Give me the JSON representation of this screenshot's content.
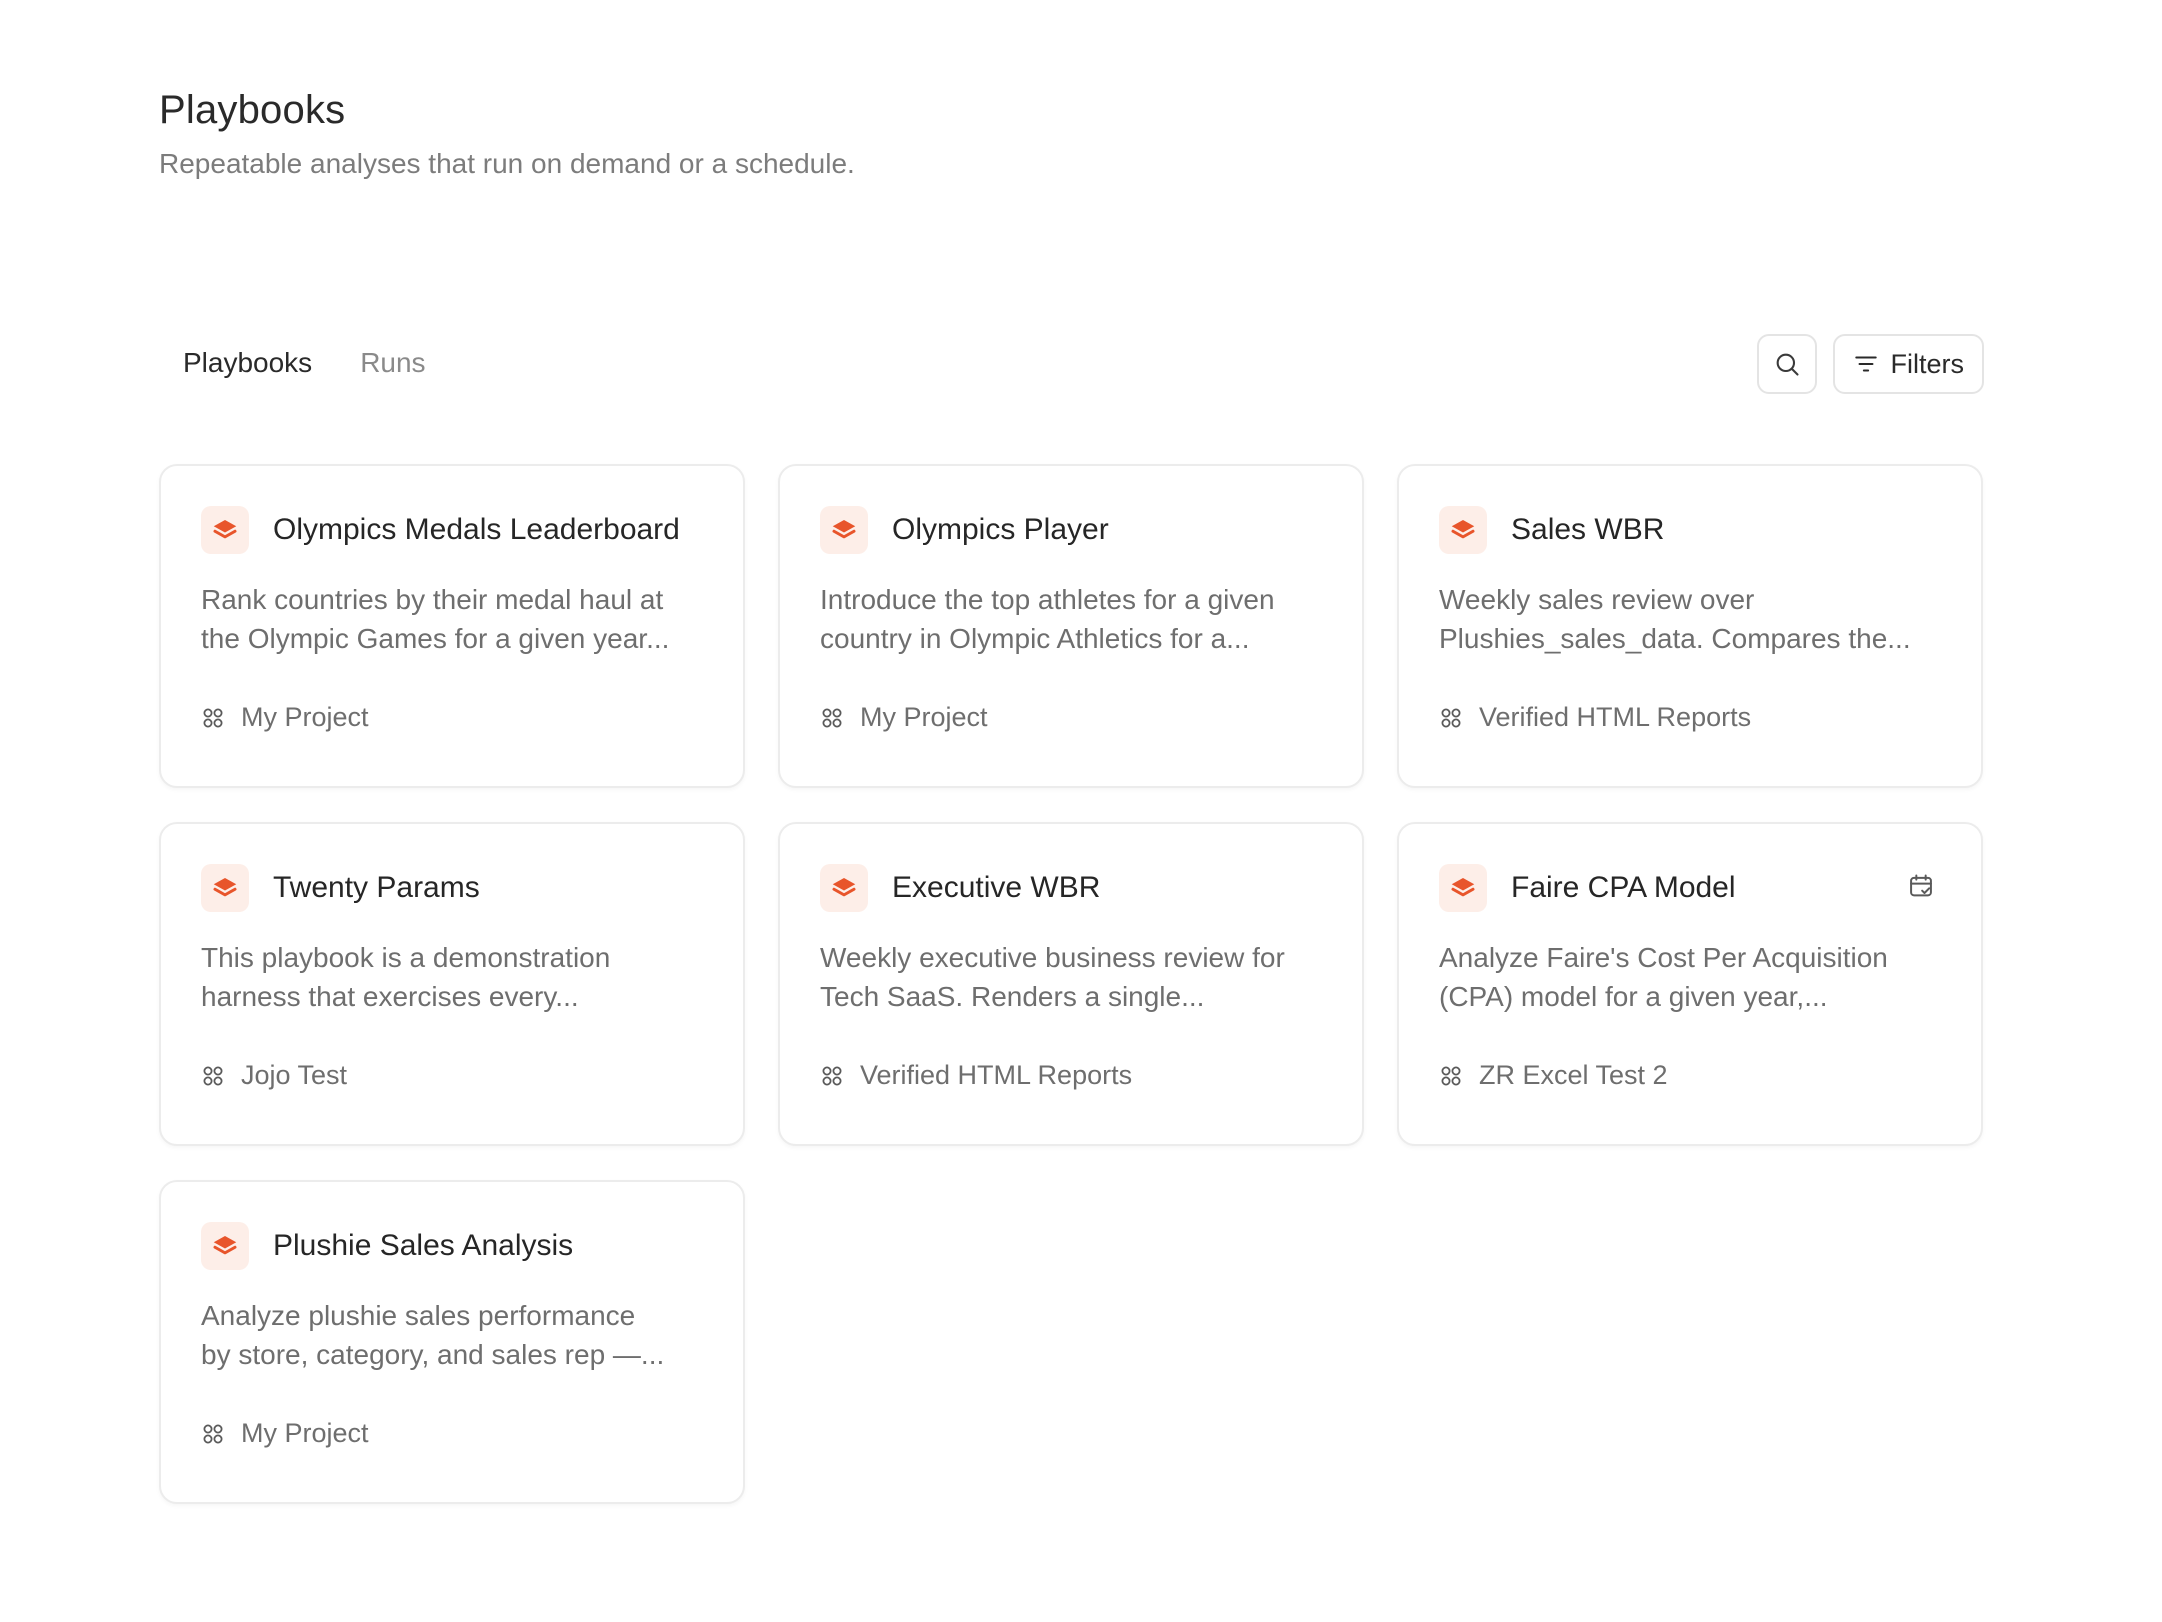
{
  "header": {
    "title": "Playbooks",
    "subtitle": "Repeatable analyses that run on demand or a schedule."
  },
  "tabs": [
    {
      "label": "Playbooks",
      "active": true
    },
    {
      "label": "Runs",
      "active": false
    }
  ],
  "toolbar": {
    "search_icon": "search-icon",
    "filters_label": "Filters",
    "filters_icon": "filter-lines-icon"
  },
  "colors": {
    "accent": "#e8552b",
    "accent_bg": "#fdeee8"
  },
  "cards": [
    {
      "title": "Olympics Medals Leaderboard",
      "desc1": "Rank countries by their medal haul at",
      "desc2": "the Olympic Games for a given year...",
      "project": "My Project",
      "scheduled": false
    },
    {
      "title": "Olympics Player",
      "desc1": "Introduce the top athletes for a given",
      "desc2": "country in Olympic Athletics for a...",
      "project": "My Project",
      "scheduled": false
    },
    {
      "title": "Sales WBR",
      "desc1": "Weekly sales review over",
      "desc2": "Plushies_sales_data. Compares the...",
      "project": "Verified HTML Reports",
      "scheduled": false
    },
    {
      "title": "Twenty Params",
      "desc1": "This playbook is a demonstration",
      "desc2": "harness that exercises every...",
      "project": "Jojo Test",
      "scheduled": false
    },
    {
      "title": "Executive WBR",
      "desc1": "Weekly executive business review for",
      "desc2": "Tech SaaS. Renders a single...",
      "project": "Verified HTML Reports",
      "scheduled": false
    },
    {
      "title": "Faire CPA Model",
      "desc1": "Analyze Faire's Cost Per Acquisition",
      "desc2": "(CPA) model for a given year,...",
      "project": "ZR Excel Test 2",
      "scheduled": true
    },
    {
      "title": "Plushie Sales Analysis",
      "desc1": "Analyze plushie sales performance",
      "desc2": "by store, category, and sales rep —...",
      "project": "My Project",
      "scheduled": false
    }
  ]
}
